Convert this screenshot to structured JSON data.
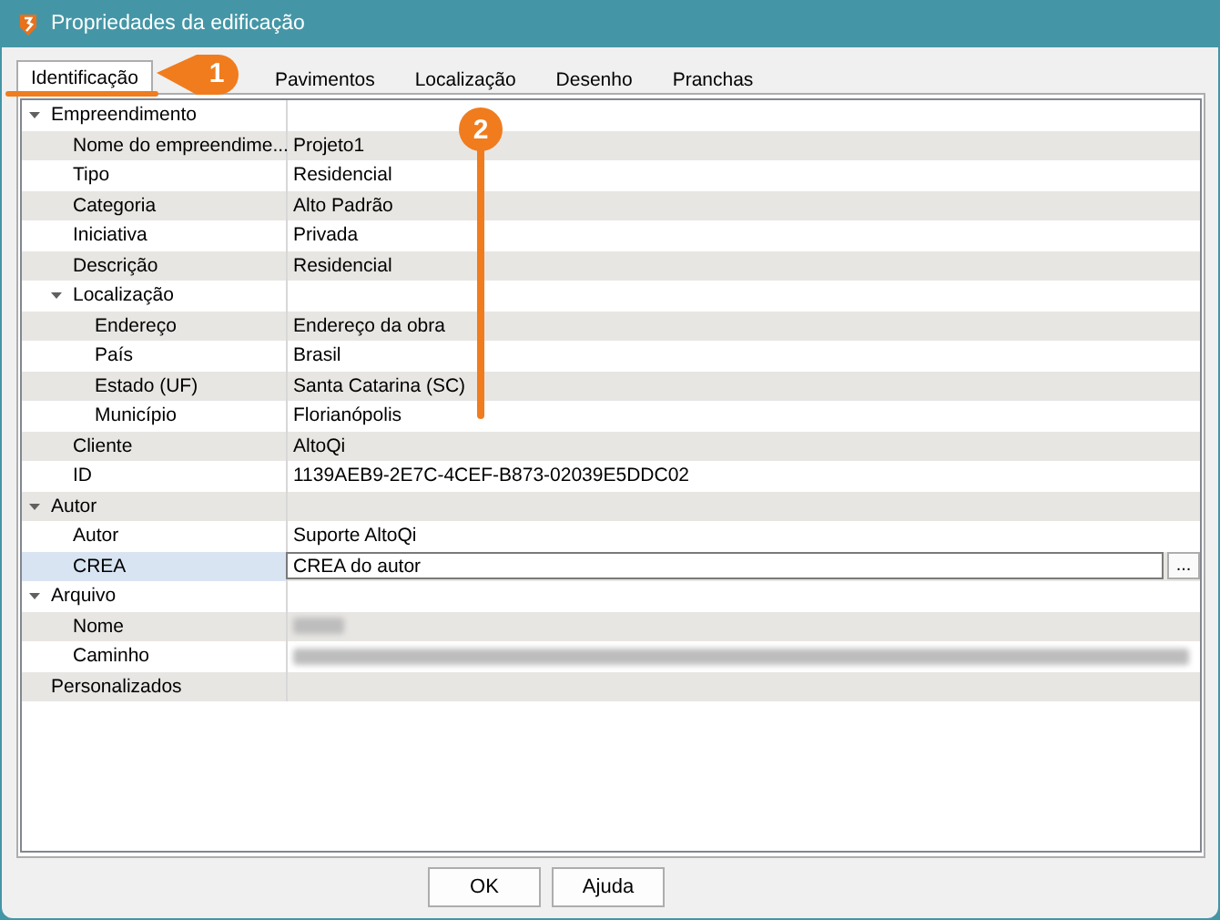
{
  "window": {
    "title": "Propriedades da edificação"
  },
  "tabs": [
    {
      "label": "Identificação",
      "selected": true
    },
    {
      "label": "Pavimentos",
      "selected": false
    },
    {
      "label": "Localização",
      "selected": false
    },
    {
      "label": "Desenho",
      "selected": false
    },
    {
      "label": "Pranchas",
      "selected": false
    }
  ],
  "tree": [
    {
      "name": "Empreendimento",
      "expanded": true,
      "selected": false,
      "children": [
        {
          "name": "Nome do empreendime...",
          "kind": "text",
          "value": "Projeto1",
          "selected": false
        },
        {
          "name": "Tipo",
          "kind": "text",
          "value": "Residencial",
          "selected": false
        },
        {
          "name": "Categoria",
          "kind": "text",
          "value": "Alto Padrão",
          "selected": false
        },
        {
          "name": "Iniciativa",
          "kind": "text",
          "value": "Privada",
          "selected": false
        },
        {
          "name": "Descrição",
          "kind": "text",
          "value": "Residencial",
          "selected": false
        },
        {
          "name": "Localização",
          "expanded": true,
          "selected": false,
          "children": [
            {
              "name": "Endereço",
              "kind": "text",
              "value": "Endereço da obra",
              "selected": false
            },
            {
              "name": "País",
              "kind": "text",
              "value": "Brasil",
              "selected": false
            },
            {
              "name": "Estado (UF)",
              "kind": "text",
              "value": "Santa Catarina (SC)",
              "selected": false
            },
            {
              "name": "Município",
              "kind": "text",
              "value": "Florianópolis",
              "selected": false
            }
          ]
        },
        {
          "name": "Cliente",
          "kind": "text",
          "value": "AltoQi",
          "selected": false
        },
        {
          "name": "ID",
          "kind": "text",
          "value": "1139AEB9-2E7C-4CEF-B873-02039E5DDC02",
          "selected": false
        }
      ]
    },
    {
      "name": "Autor",
      "expanded": true,
      "selected": false,
      "children": [
        {
          "name": "Autor",
          "kind": "text",
          "value": "Suporte AltoQi",
          "selected": false
        },
        {
          "name": "CREA",
          "kind": "input",
          "value": "CREA do autor",
          "button": "...",
          "selected": true
        }
      ]
    },
    {
      "name": "Arquivo",
      "expanded": true,
      "selected": false,
      "children": [
        {
          "name": "Nome",
          "kind": "redacted",
          "selected": false
        },
        {
          "name": "Caminho",
          "kind": "redacted",
          "selected": false
        }
      ]
    },
    {
      "name": "Personalizados",
      "selected": false
    }
  ],
  "buttons": [
    "OK",
    "Ajuda"
  ],
  "annotations": [
    {
      "label": "1",
      "kind": "tab-pointer"
    },
    {
      "label": "2",
      "kind": "vertical-line"
    }
  ]
}
